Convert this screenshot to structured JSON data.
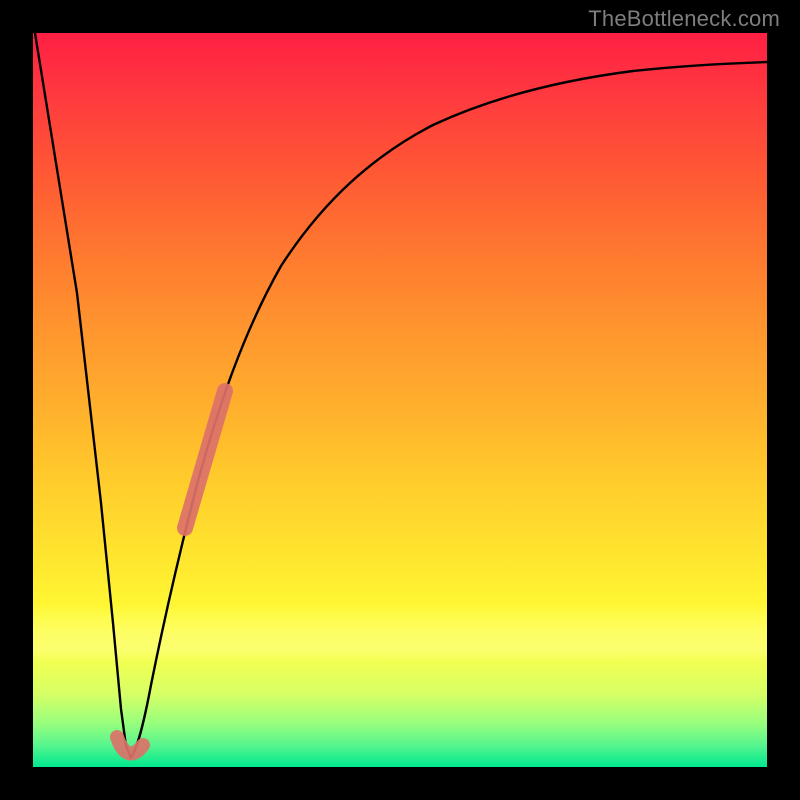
{
  "watermark": "TheBottleneck.com",
  "colors": {
    "curve_stroke": "#000000",
    "overlay_stroke": "#dc7169",
    "overlay_opacity": 0.92,
    "background_black": "#000000"
  },
  "chart_data": {
    "type": "line",
    "title": "",
    "xlabel": "",
    "ylabel": "",
    "xlim": [
      0,
      100
    ],
    "ylim": [
      0,
      100
    ],
    "legend": null,
    "description": "Bottleneck deviation curve. Vertical position encodes deviation / bottleneck percentage (top = high red, bottom = low green). Horizontal axis is relative component performance. Minimum (optimal balance point) near x≈12.",
    "series": [
      {
        "name": "bottleneck-curve",
        "x": [
          0,
          3,
          6,
          9,
          11,
          12,
          13,
          14,
          16,
          19,
          22,
          28,
          34,
          42,
          52,
          64,
          78,
          90,
          100
        ],
        "y": [
          100,
          75,
          50,
          25,
          8,
          1,
          5,
          12,
          24,
          40,
          52,
          66,
          74,
          80,
          85,
          89,
          92,
          93.7,
          94.8
        ]
      },
      {
        "name": "highlight-segment-upper",
        "note": "thick salmon overlay on the right branch (≈ x 20–25)",
        "x": [
          20,
          21.5,
          23,
          24.5,
          25.5
        ],
        "y": [
          46,
          51,
          55.5,
          60,
          63
        ]
      },
      {
        "name": "highlight-segment-minimum",
        "note": "short salmon hook at the curve minimum",
        "x": [
          10.5,
          11.5,
          12.5,
          13.5
        ],
        "y": [
          5,
          1.5,
          2,
          5
        ]
      }
    ]
  }
}
